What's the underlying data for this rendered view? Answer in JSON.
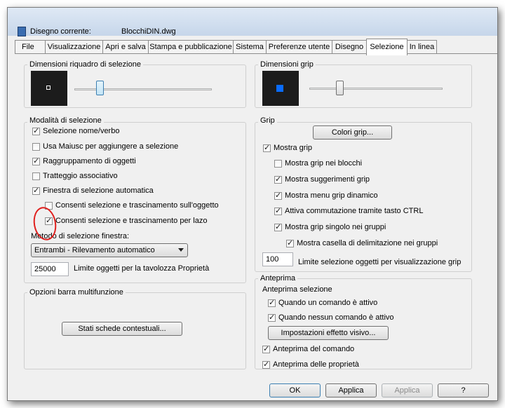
{
  "window": {
    "current_drawing_label": "Disegno corrente:",
    "current_drawing_value": "BlocchiDIN.dwg"
  },
  "tabs": [
    {
      "label": "File"
    },
    {
      "label": "Visualizzazione"
    },
    {
      "label": "Apri e salva"
    },
    {
      "label": "Stampa e pubblicazione"
    },
    {
      "label": "Sistema"
    },
    {
      "label": "Preferenze utente"
    },
    {
      "label": "Disegno"
    },
    {
      "label": "Selezione",
      "active": true
    },
    {
      "label": "In linea"
    }
  ],
  "left": {
    "pickbox": {
      "title": "Dimensioni riquadro di selezione",
      "slider_value": 0.18
    },
    "selection_modes": {
      "title": "Modalità di selezione",
      "items": [
        {
          "label": "Selezione nome/verbo",
          "checked": true
        },
        {
          "label": "Usa Maiusc per aggiungere a selezione",
          "checked": false
        },
        {
          "label": "Raggruppamento di oggetti",
          "checked": true
        },
        {
          "label": "Tratteggio associativo",
          "checked": false
        },
        {
          "label": "Finestra di selezione automatica",
          "checked": true
        },
        {
          "label": "Consenti selezione e trascinamento sull'oggetto",
          "checked": false
        },
        {
          "label": "Consenti selezione e trascinamento per lazo",
          "checked": true
        }
      ],
      "window_method_label": "Metodo di selezione finestra:",
      "window_method_value": "Entrambi - Rilevamento automatico",
      "limit_value": "25000",
      "limit_label": "Limite oggetti per la tavolozza Proprietà"
    },
    "ribbon": {
      "title": "Opzioni barra multifunzione",
      "button": "Stati schede contestuali..."
    }
  },
  "right": {
    "grip_size": {
      "title": "Dimensioni grip",
      "slider_value": 0.22
    },
    "grip": {
      "title": "Grip",
      "colors_button": "Colori grip...",
      "items": [
        {
          "label": "Mostra grip",
          "checked": true
        },
        {
          "label": "Mostra grip nei blocchi",
          "checked": false
        },
        {
          "label": "Mostra suggerimenti grip",
          "checked": true
        },
        {
          "label": "Mostra menu grip dinamico",
          "checked": true
        },
        {
          "label": "Attiva commutazione tramite tasto CTRL",
          "checked": true
        },
        {
          "label": "Mostra grip singolo nei gruppi",
          "checked": true
        },
        {
          "label": "Mostra casella di delimitazione nei gruppi",
          "checked": true
        }
      ],
      "limit_value": "100",
      "limit_label": "Limite selezione oggetti per visualizzazione grip"
    },
    "preview": {
      "title": "Anteprima",
      "sub_title": "Anteprima selezione",
      "items": [
        {
          "label": "Quando un comando è attivo",
          "checked": true
        },
        {
          "label": "Quando nessun comando è attivo",
          "checked": true
        }
      ],
      "effects_button": "Impostazioni effetto visivo...",
      "items2": [
        {
          "label": "Anteprima del comando",
          "checked": true
        },
        {
          "label": "Anteprima delle proprietà",
          "checked": true
        }
      ]
    }
  },
  "footer": {
    "ok": "OK",
    "apply_all": "Applica",
    "apply": "Applica",
    "help": "?"
  },
  "colors": {
    "grip_preview": "#0a6cff",
    "annotation": "#e0201e"
  }
}
